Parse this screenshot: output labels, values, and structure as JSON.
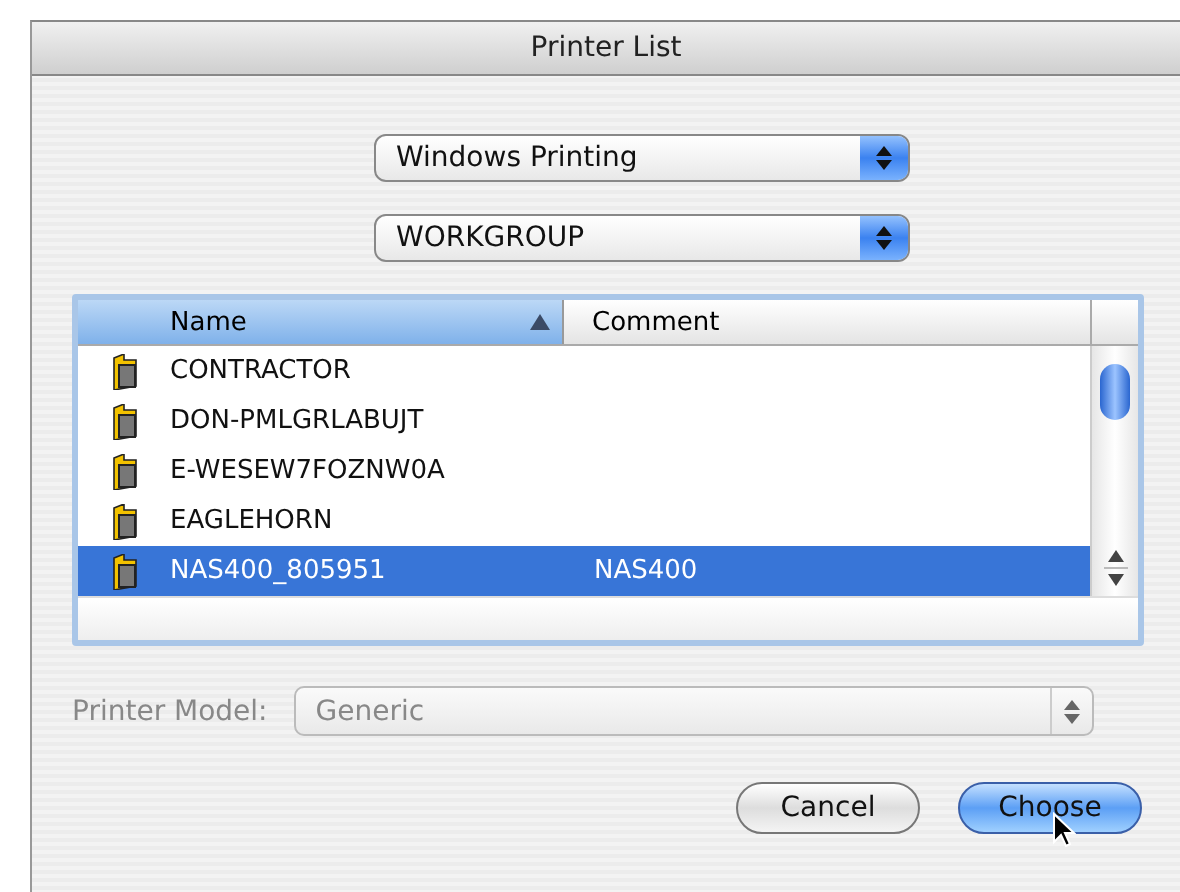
{
  "window": {
    "title": "Printer List"
  },
  "popups": [
    {
      "value": "Windows Printing"
    },
    {
      "value": "WORKGROUP"
    }
  ],
  "list": {
    "columns": [
      {
        "label": "Name",
        "sorted": true
      },
      {
        "label": "Comment",
        "sorted": false
      }
    ],
    "rows": [
      {
        "name": "CONTRACTOR",
        "comment": "",
        "selected": false
      },
      {
        "name": "DON-PMLGRLABUJT",
        "comment": "",
        "selected": false
      },
      {
        "name": "E-WESEW7FOZNW0A",
        "comment": "",
        "selected": false
      },
      {
        "name": "EAGLEHORN",
        "comment": "",
        "selected": false
      },
      {
        "name": "NAS400_805951",
        "comment": "NAS400",
        "selected": true
      }
    ]
  },
  "printer_model": {
    "label": "Printer Model:",
    "value": "Generic",
    "disabled": true
  },
  "buttons": [
    {
      "label": "Cancel",
      "default": false
    },
    {
      "label": "Choose",
      "default": true
    }
  ]
}
